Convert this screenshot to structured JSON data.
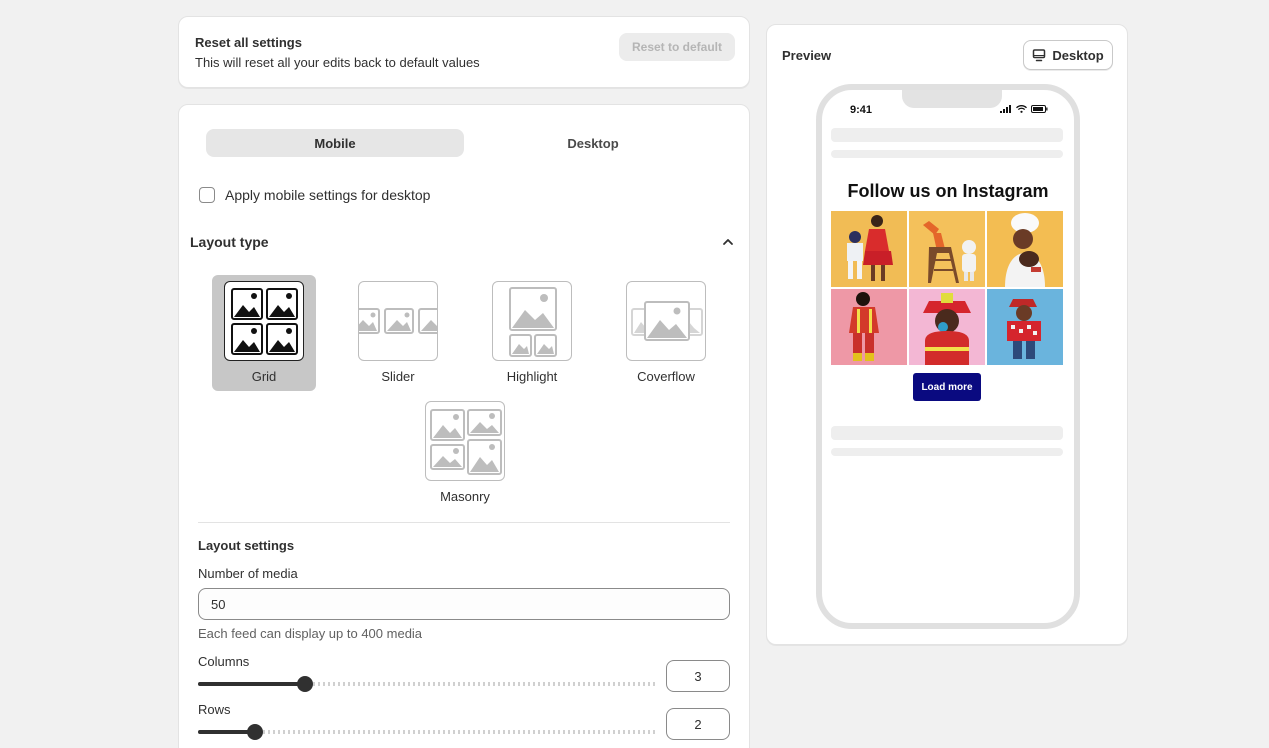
{
  "reset": {
    "title": "Reset all settings",
    "description": "This will reset all your edits back to default values",
    "button_label": "Reset to default"
  },
  "tabs": {
    "mobile": "Mobile",
    "desktop": "Desktop",
    "active": "Mobile"
  },
  "apply_mobile": {
    "label": "Apply mobile settings for desktop",
    "checked": false
  },
  "layout_type": {
    "title": "Layout type",
    "options": [
      {
        "label": "Grid",
        "selected": true,
        "icon": "grid-layout-icon"
      },
      {
        "label": "Slider",
        "selected": false,
        "icon": "slider-layout-icon"
      },
      {
        "label": "Highlight",
        "selected": false,
        "icon": "highlight-layout-icon"
      },
      {
        "label": "Coverflow",
        "selected": false,
        "icon": "coverflow-layout-icon"
      },
      {
        "label": "Masonry",
        "selected": false,
        "icon": "masonry-layout-icon"
      }
    ]
  },
  "layout_settings": {
    "title": "Layout settings",
    "media_label": "Number of media",
    "media_value": "50",
    "media_help": "Each feed can display up to 400 media",
    "columns_label": "Columns",
    "columns_value": "3",
    "rows_label": "Rows",
    "rows_value": "2"
  },
  "preview": {
    "title": "Preview",
    "device_button": "Desktop",
    "phone_time": "9:41",
    "feed_title": "Follow us on Instagram",
    "load_more": "Load more",
    "tile_colors": [
      "#f1bc55",
      "#f4c15b",
      "#f3bd52",
      "#ee98a6",
      "#f3b7d4",
      "#6ab4dd"
    ]
  },
  "colors": {
    "background": "#f1f1f1",
    "card": "#ffffff",
    "load_more_bg": "#0a0a80",
    "selected_option": "#c7c7c7"
  }
}
